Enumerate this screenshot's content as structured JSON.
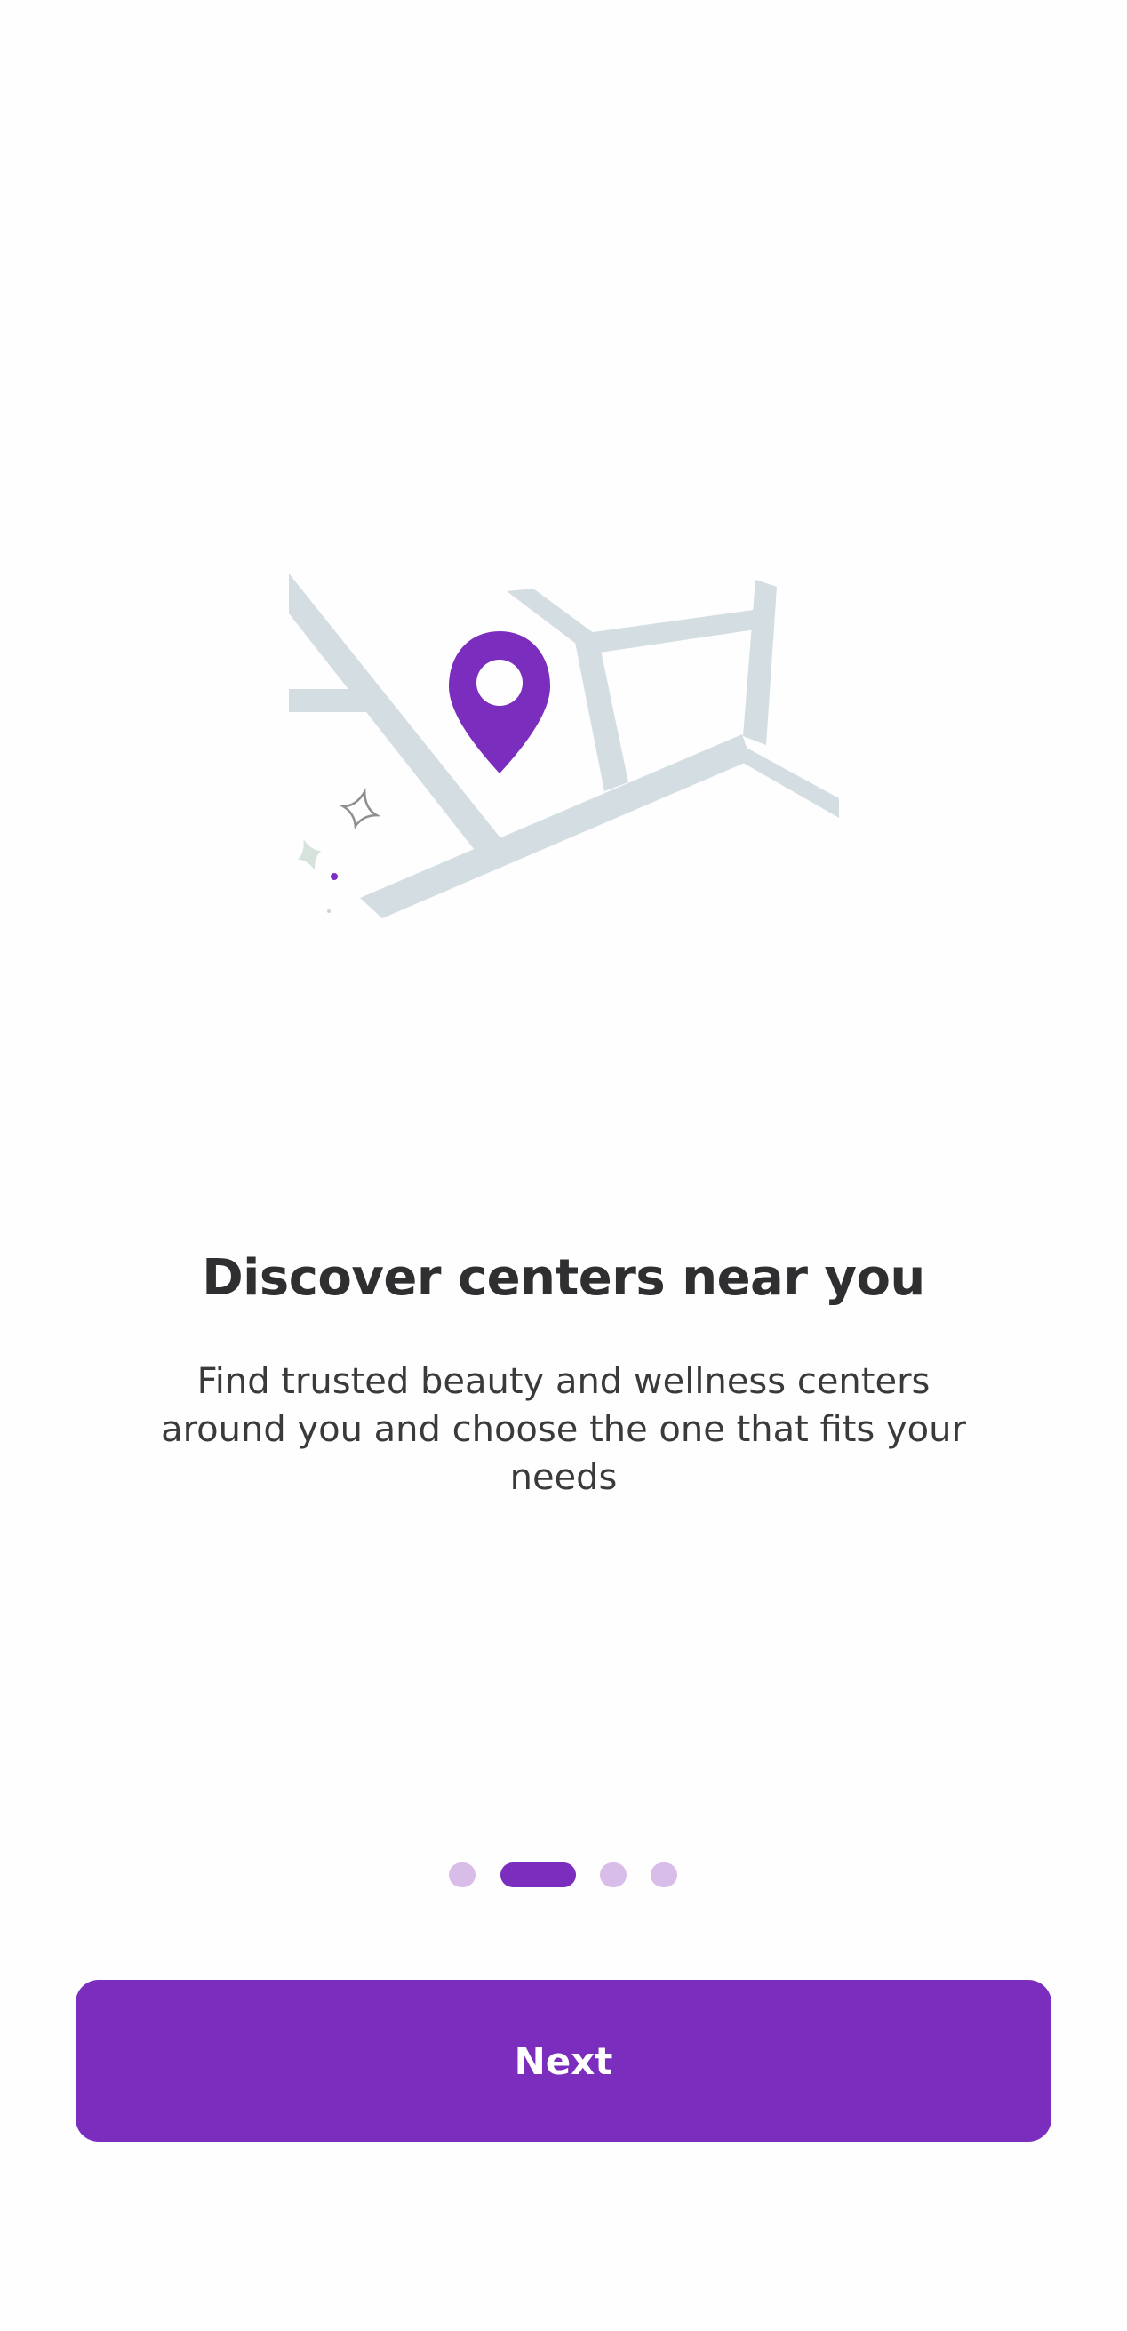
{
  "onboarding": {
    "title": "Discover centers near you",
    "description": "Find trusted beauty and wellness centers around you and choose the one that fits your needs",
    "next_label": "Next"
  },
  "pagination": {
    "total": 4,
    "active_index": 1
  },
  "illustration": {
    "icon": "map-pin-icon",
    "pin_color": "#7b2dbd",
    "road_color": "#d3dde2"
  },
  "colors": {
    "accent": "#7b2dbd",
    "accent_light": "#d9bde9",
    "text": "#2f2f31"
  }
}
